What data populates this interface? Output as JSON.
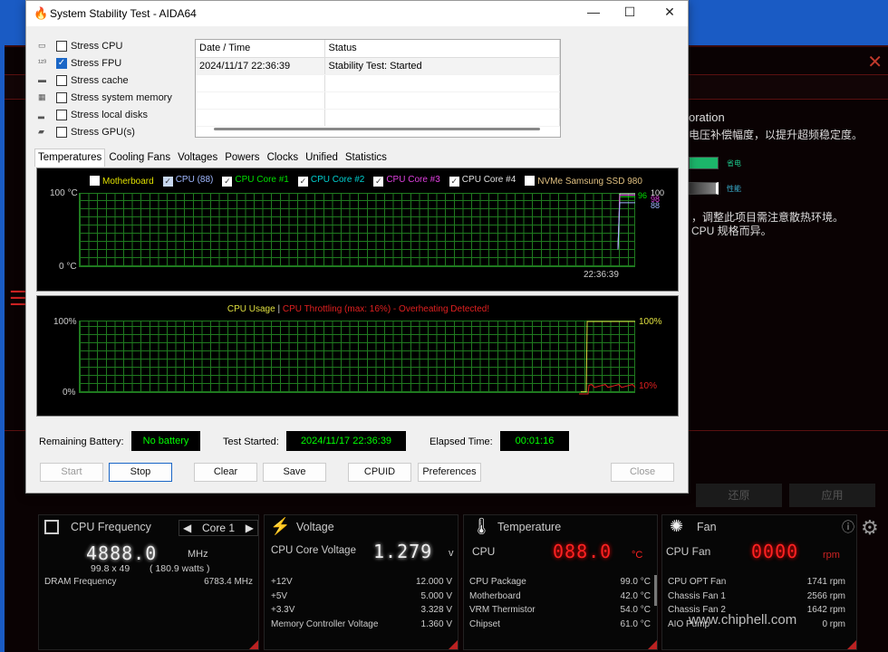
{
  "rog": {
    "heading_partial": "oration",
    "desc1_partial": "电压补偿幅度，以提升超频稳定度。",
    "bar1_label": "省电",
    "bar2_label": "性能",
    "desc2_partial": "，调整此项目需注意散热环境。",
    "desc3_partial": "CPU 规格而异。",
    "reset_label": "还原",
    "apply_label": "应用",
    "cpu_freq": {
      "title": "CPU Frequency",
      "core_selector": "Core 1",
      "value": "4888.0",
      "unit": "MHz",
      "multiplier": "99.8  x  49",
      "watts": "( 180.9 watts )",
      "dram_label": "DRAM Frequency",
      "dram_value": "6783.4  MHz"
    },
    "voltage": {
      "title": "Voltage",
      "main_label": "CPU Core Voltage",
      "main_value": "1.279",
      "main_unit": "v",
      "rows": [
        {
          "label": "+12V",
          "value": "12.000  V"
        },
        {
          "label": "+5V",
          "value": "5.000  V"
        },
        {
          "label": "+3.3V",
          "value": "3.328  V"
        },
        {
          "label": "Memory Controller Voltage",
          "value": "1.360  V"
        }
      ]
    },
    "temperature": {
      "title": "Temperature",
      "main_label": "CPU",
      "main_value": "088.0",
      "main_unit": "°C",
      "rows": [
        {
          "label": "CPU Package",
          "value": "99.0 °C"
        },
        {
          "label": "Motherboard",
          "value": "42.0 °C"
        },
        {
          "label": "VRM Thermistor",
          "value": "54.0 °C"
        },
        {
          "label": "Chipset",
          "value": "61.0 °C"
        }
      ]
    },
    "fan": {
      "title": "Fan",
      "main_label": "CPU Fan",
      "main_value": "0000",
      "main_unit": "rpm",
      "rows": [
        {
          "label": "CPU OPT Fan",
          "value": "1741  rpm"
        },
        {
          "label": "Chassis Fan 1",
          "value": "2566  rpm"
        },
        {
          "label": "Chassis Fan 2",
          "value": "1642  rpm"
        },
        {
          "label": "AIO Pump",
          "value": "0  rpm"
        }
      ]
    },
    "watermark": "www.chiphell.com"
  },
  "aida": {
    "title": "System Stability Test - AIDA64",
    "stress": [
      {
        "label": "Stress CPU",
        "checked": false
      },
      {
        "label": "Stress FPU",
        "checked": true
      },
      {
        "label": "Stress cache",
        "checked": false
      },
      {
        "label": "Stress system memory",
        "checked": false
      },
      {
        "label": "Stress local disks",
        "checked": false
      },
      {
        "label": "Stress GPU(s)",
        "checked": false
      }
    ],
    "log": {
      "headers": [
        "Date / Time",
        "Status"
      ],
      "rows": [
        [
          "2024/11/17 22:36:39",
          "Stability Test: Started"
        ]
      ]
    },
    "tabs": [
      "Temperatures",
      "Cooling Fans",
      "Voltages",
      "Powers",
      "Clocks",
      "Unified",
      "Statistics"
    ],
    "active_tab": "Temperatures",
    "temp_chart": {
      "legend": [
        {
          "label": "Motherboard",
          "checked": false,
          "color": "#e0e000"
        },
        {
          "label": "CPU (88)",
          "checked": true,
          "color": "#a0b8ff"
        },
        {
          "label": "CPU Core #1",
          "checked": true,
          "color": "#00e000"
        },
        {
          "label": "CPU Core #2",
          "checked": true,
          "color": "#00d0d0"
        },
        {
          "label": "CPU Core #3",
          "checked": true,
          "color": "#e040e0"
        },
        {
          "label": "CPU Core #4",
          "checked": true,
          "color": "#e0e0e0"
        },
        {
          "label": "NVMe Samsung SSD 980",
          "checked": false,
          "color": "#e0c080"
        }
      ],
      "y_top": "100 °C",
      "y_bottom": "0 °C",
      "x_label": "22:36:39",
      "right_labels": [
        {
          "text": "96",
          "color": "#00e000"
        },
        {
          "text": "100",
          "color": "#e0e0e0"
        },
        {
          "text": "98",
          "color": "#e040e0"
        },
        {
          "text": "88",
          "color": "#a0b8ff"
        }
      ]
    },
    "usage_chart": {
      "title_usage": "CPU Usage",
      "separator": "|",
      "title_throttle": "CPU Throttling (max: 16%) - Overheating Detected!",
      "y_top": "100%",
      "y_bottom": "0%",
      "usage_end": "100%",
      "throttle_end": "10%",
      "usage_color": "#e0e040",
      "throttle_color": "#e02020"
    },
    "battery_label": "Remaining Battery:",
    "battery_value": "No battery",
    "started_label": "Test Started:",
    "started_value": "2024/11/17 22:36:39",
    "elapsed_label": "Elapsed Time:",
    "elapsed_value": "00:01:16",
    "buttons": {
      "start": "Start",
      "stop": "Stop",
      "clear": "Clear",
      "save": "Save",
      "cpuid": "CPUID",
      "preferences": "Preferences",
      "close": "Close"
    }
  },
  "chart_data": [
    {
      "type": "line",
      "ylim": [
        0,
        100
      ],
      "series": [
        {
          "name": "CPU Core #1",
          "end_value": 96
        },
        {
          "name": "CPU Core #4",
          "end_value": 100
        },
        {
          "name": "CPU Core #3",
          "end_value": 98
        },
        {
          "name": "CPU (88)",
          "end_value": 88
        }
      ]
    },
    {
      "type": "line",
      "ylim": [
        0,
        100
      ],
      "series": [
        {
          "name": "CPU Usage",
          "end_value": 100
        },
        {
          "name": "CPU Throttling",
          "end_value": 10,
          "max": 16
        }
      ]
    }
  ]
}
